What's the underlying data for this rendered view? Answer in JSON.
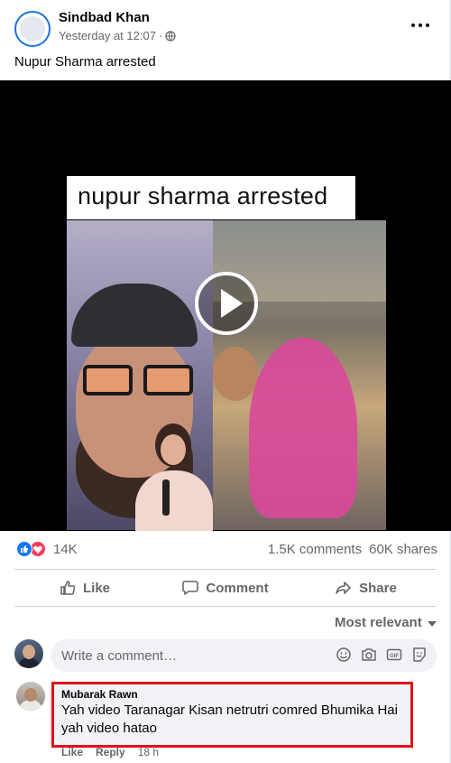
{
  "post": {
    "author": "Sindbad Khan",
    "timestamp": "Yesterday at 12:07",
    "separator": "·",
    "privacy_icon": "globe-icon",
    "caption": "Nupur Sharma arrested"
  },
  "video": {
    "overlay_title": "nupur sharma arrested",
    "play_icon": "play-icon"
  },
  "stats": {
    "reaction_icons": [
      "like-reaction-icon",
      "love-reaction-icon"
    ],
    "reaction_count": "14K",
    "comments": "1.5K comments",
    "shares": "60K shares"
  },
  "actions": {
    "like": "Like",
    "comment": "Comment",
    "share": "Share"
  },
  "sort": {
    "label": "Most relevant"
  },
  "composer": {
    "placeholder": "Write a comment…"
  },
  "comments": [
    {
      "name": "Mubarak Rawn",
      "text": "Yah video Taranagar Kisan netrutri comred Bhumika Hai yah video hatao",
      "like": "Like",
      "reply": "Reply",
      "age": "18 h"
    }
  ],
  "colors": {
    "brand": "#1877f2",
    "love": "#f33e58",
    "highlight": "#e0131b",
    "secondary_text": "#65676b"
  }
}
